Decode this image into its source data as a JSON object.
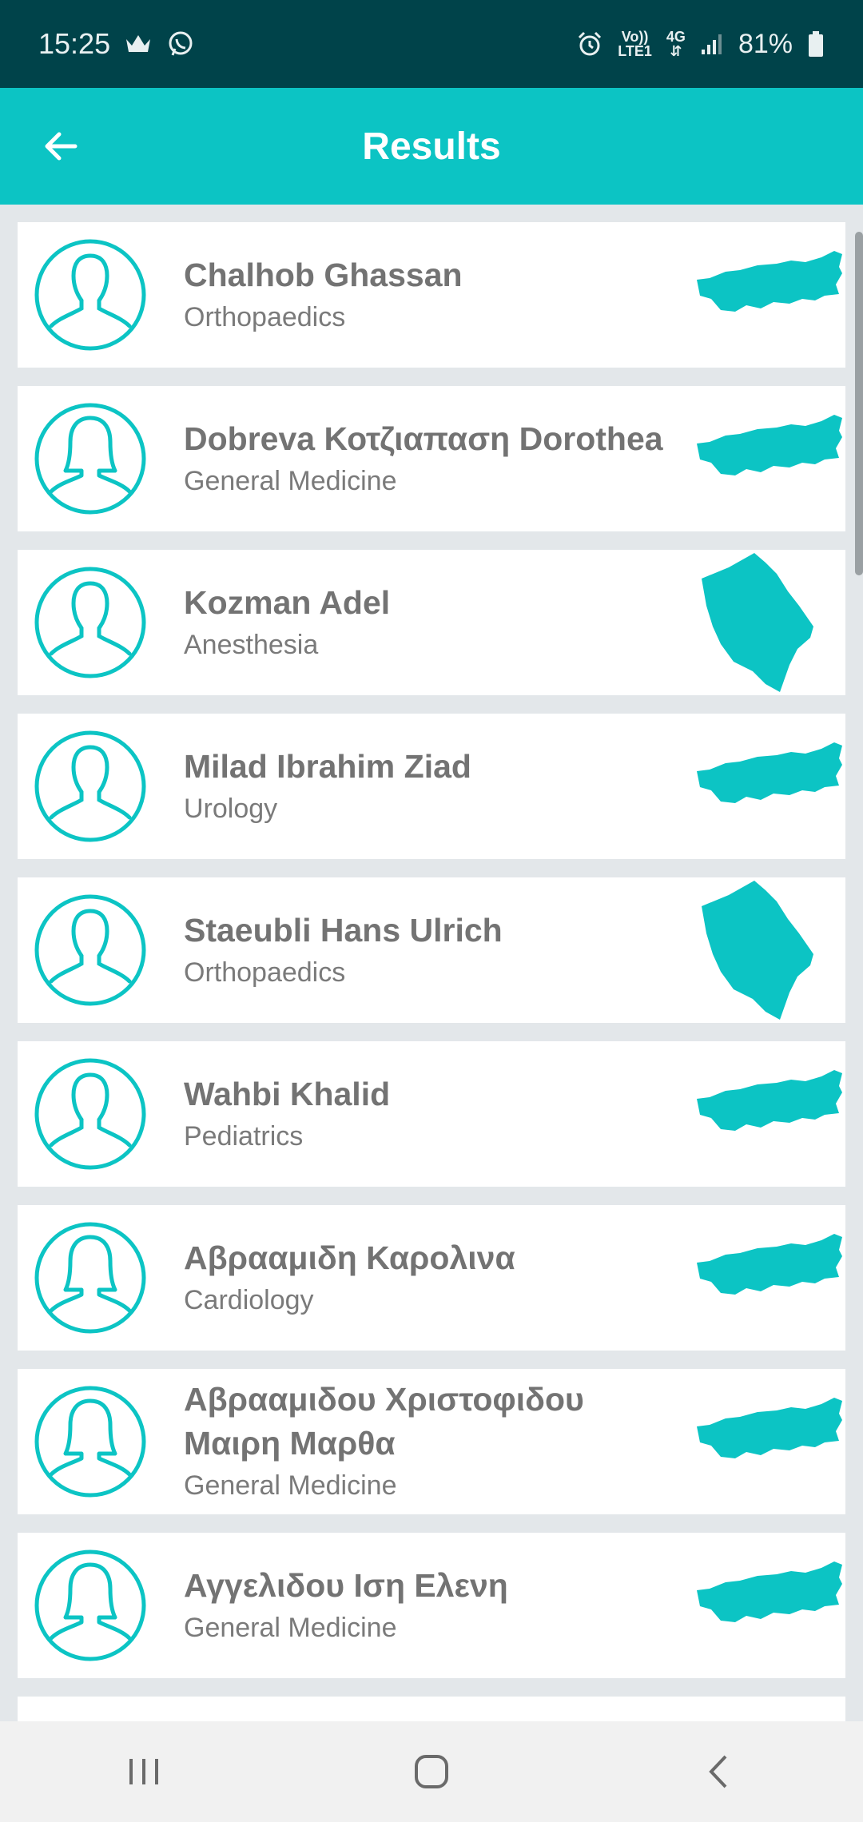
{
  "status_bar": {
    "time": "15:25",
    "signal_label_top": "Vo))",
    "signal_label_bottom": "LTE1",
    "network": "4G",
    "battery": "81%"
  },
  "header": {
    "title": "Results"
  },
  "results": [
    {
      "name": "Chalhob Ghassan",
      "specialty": "Orthopaedics",
      "avatar": "male-avatar-icon",
      "map": "map-wide"
    },
    {
      "name": "Dobreva Κοτζιαπαση Dorothea",
      "specialty": "General Medicine",
      "avatar": "female-avatar-icon",
      "map": "map-wide"
    },
    {
      "name": "Kozman Adel",
      "specialty": "Anesthesia",
      "avatar": "male-avatar-icon",
      "map": "map-tall"
    },
    {
      "name": "Milad Ibrahim Ziad",
      "specialty": "Urology",
      "avatar": "male-avatar-icon",
      "map": "map-wide"
    },
    {
      "name": "Staeubli Hans Ulrich",
      "specialty": "Orthopaedics",
      "avatar": "male-avatar-icon",
      "map": "map-tall"
    },
    {
      "name": "Wahbi Khalid",
      "specialty": "Pediatrics",
      "avatar": "male-avatar-icon",
      "map": "map-wide"
    },
    {
      "name": "Αβρααμιδη Καρολινα",
      "specialty": "Cardiology",
      "avatar": "female-avatar-icon",
      "map": "map-wide"
    },
    {
      "name": "Αβρααμιδου Χριστοφιδου Μαιρη Μαρθα",
      "specialty": "General Medicine",
      "avatar": "female-avatar-icon",
      "map": "map-wide"
    },
    {
      "name": "Αγγελιδου Ιση Ελενη",
      "specialty": "General Medicine",
      "avatar": "female-avatar-icon",
      "map": "map-wide"
    }
  ],
  "colors": {
    "accent": "#0cc4c4",
    "status_bar": "#00434a",
    "text": "#737373"
  }
}
